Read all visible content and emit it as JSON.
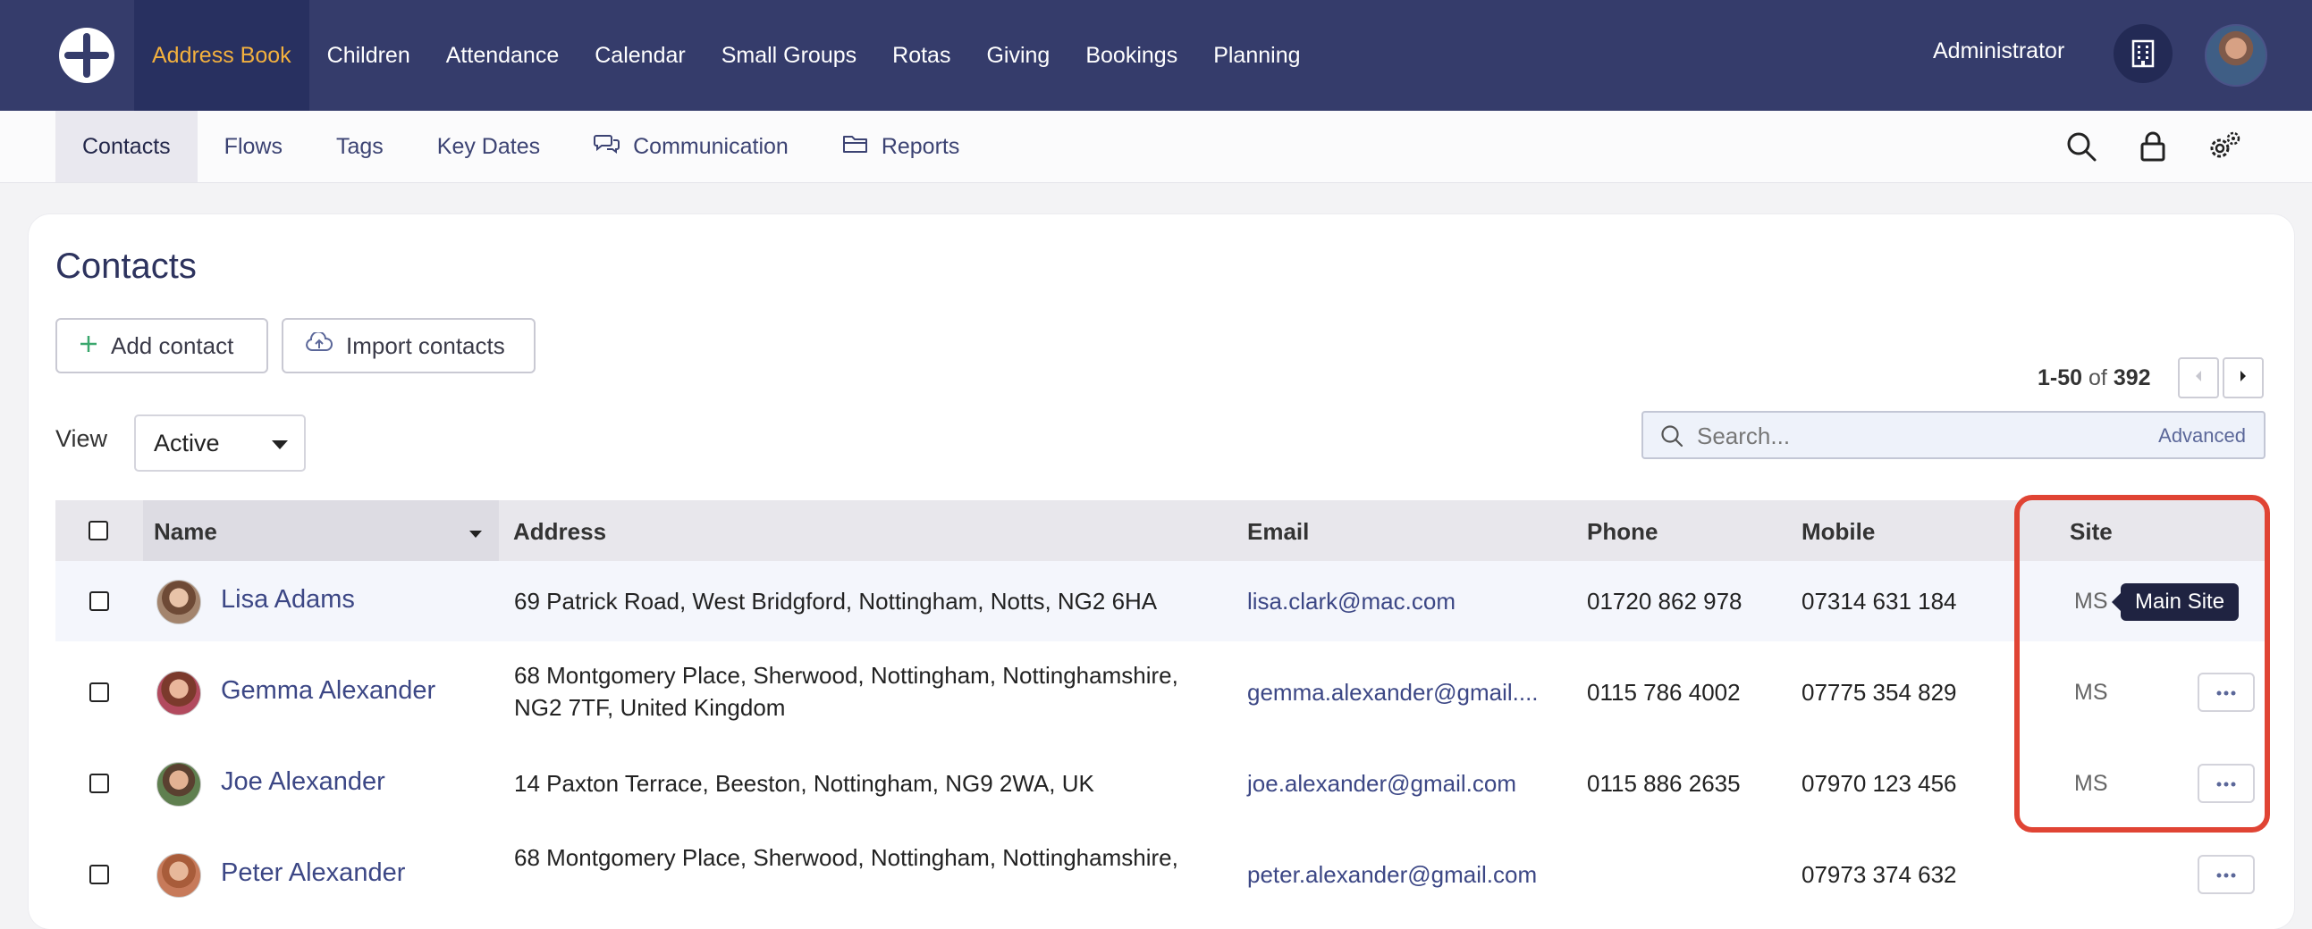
{
  "topnav": {
    "items": [
      {
        "label": "Address Book"
      },
      {
        "label": "Children"
      },
      {
        "label": "Attendance"
      },
      {
        "label": "Calendar"
      },
      {
        "label": "Small Groups"
      },
      {
        "label": "Rotas"
      },
      {
        "label": "Giving"
      },
      {
        "label": "Bookings"
      },
      {
        "label": "Planning"
      }
    ],
    "user_label": "Administrator",
    "accent_color": "#f3b13e",
    "bg_color": "#353c6b"
  },
  "subnav": {
    "tabs": [
      {
        "label": "Contacts"
      },
      {
        "label": "Flows"
      },
      {
        "label": "Tags"
      },
      {
        "label": "Key Dates"
      },
      {
        "label": "Communication",
        "icon": "chat-icon"
      },
      {
        "label": "Reports",
        "icon": "folder-icon"
      }
    ],
    "right_icons": [
      "search-icon",
      "lock-icon",
      "settings-icon"
    ]
  },
  "page": {
    "title": "Contacts",
    "add_label": "Add contact",
    "import_label": "Import contacts"
  },
  "pager": {
    "range": "1-50",
    "of_label": "of",
    "total": "392"
  },
  "view": {
    "label": "View",
    "selected": "Active"
  },
  "search": {
    "placeholder": "Search...",
    "advanced_label": "Advanced"
  },
  "table": {
    "columns": {
      "name": "Name",
      "address": "Address",
      "email": "Email",
      "phone": "Phone",
      "mobile": "Mobile",
      "site": "Site"
    },
    "rows": [
      {
        "name": "Lisa Adams",
        "address_line1": "69 Patrick Road, West Bridgford, Nottingham, Notts, NG2 6HA",
        "address_line2": "",
        "email": "lisa.clark@mac.com",
        "phone": "01720 862 978",
        "mobile": "07314 631 184",
        "site": "MS"
      },
      {
        "name": "Gemma Alexander",
        "address_line1": "68 Montgomery Place, Sherwood, Nottingham, Nottinghamshire,",
        "address_line2": "NG2 7TF, United Kingdom",
        "email": "gemma.alexander@gmail....",
        "phone": "0115 786 4002",
        "mobile": "07775 354 829",
        "site": "MS"
      },
      {
        "name": "Joe Alexander",
        "address_line1": "14 Paxton Terrace, Beeston, Nottingham, NG9 2WA, UK",
        "address_line2": "",
        "email": "joe.alexander@gmail.com",
        "phone": "0115 886 2635",
        "mobile": "07970 123 456",
        "site": "MS"
      },
      {
        "name": "Peter Alexander",
        "address_line1": "68 Montgomery Place, Sherwood, Nottingham, Nottinghamshire,",
        "address_line2": "",
        "email": "peter.alexander@gmail.com",
        "phone": "",
        "mobile": "07973 374 632",
        "site": ""
      }
    ]
  },
  "tooltip": {
    "text": "Main Site"
  },
  "highlight_color": "#e04434"
}
